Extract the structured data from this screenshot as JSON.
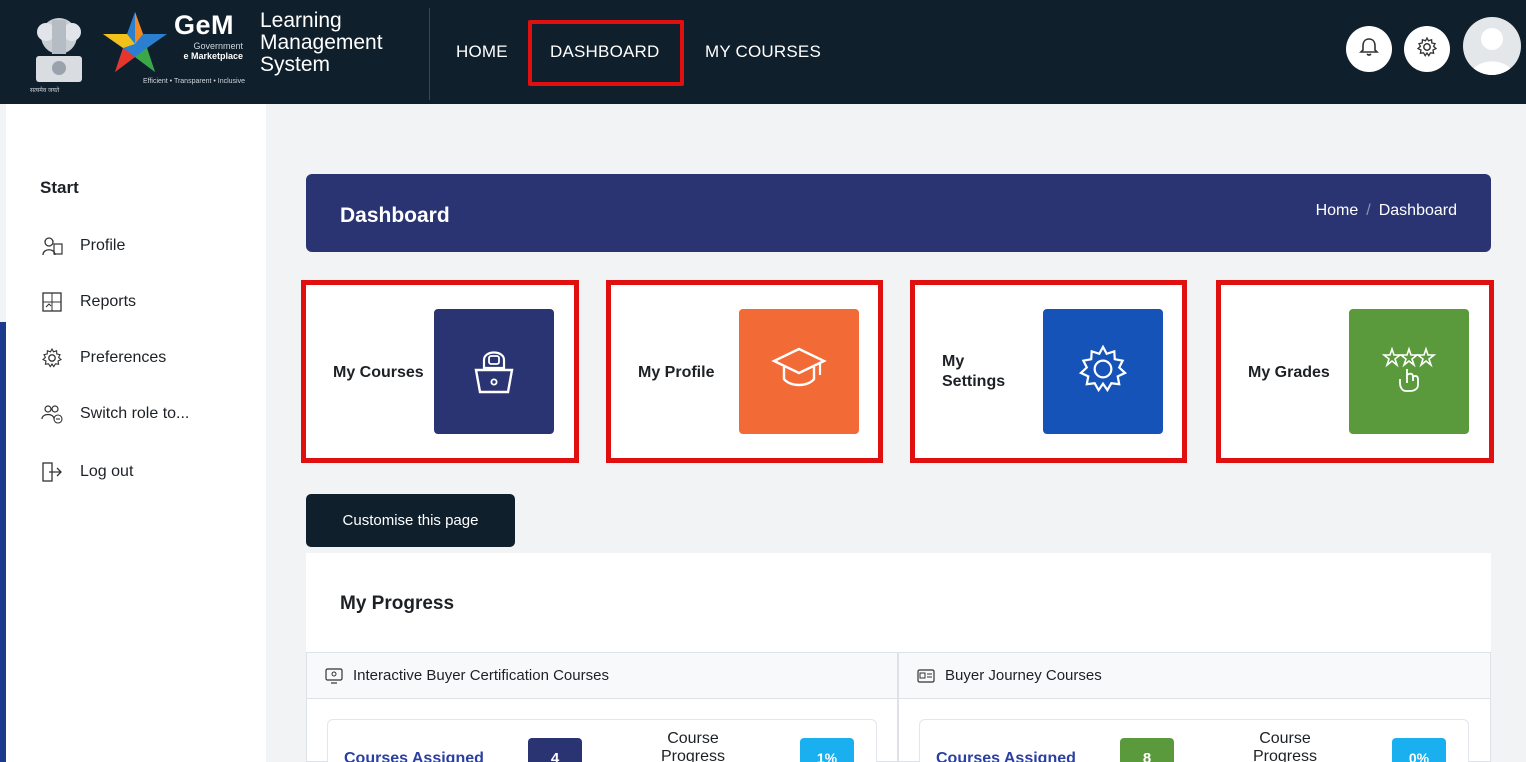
{
  "header": {
    "brand_word": "GeM",
    "brand_sub1": "Government",
    "brand_sub2": "e Marketplace",
    "brand_tagline": "Efficient • Transparent • Inclusive",
    "emblem_caption": "सत्यमेव जयते",
    "lms_title": "Learning Management System",
    "nav": {
      "home": "HOME",
      "dashboard": "DASHBOARD",
      "my_courses": "MY COURSES"
    },
    "icons": {
      "notifications": "bell-icon",
      "settings": "gear-icon",
      "avatar": "user-avatar"
    }
  },
  "sidebar": {
    "section": "Start",
    "items": [
      {
        "label": "Profile",
        "icon": "profile-icon"
      },
      {
        "label": "Reports",
        "icon": "reports-icon"
      },
      {
        "label": "Preferences",
        "icon": "gear-icon"
      },
      {
        "label": "Switch role to...",
        "icon": "switch-role-icon"
      },
      {
        "label": "Log out",
        "icon": "logout-icon"
      }
    ]
  },
  "banner": {
    "title": "Dashboard",
    "breadcrumb": [
      "Home",
      "Dashboard"
    ],
    "separator": "/"
  },
  "tiles": [
    {
      "label": "My Courses",
      "icon": "laptop-user-icon",
      "color": "#2b3473"
    },
    {
      "label": "My Profile",
      "icon": "graduation-cap-icon",
      "color": "#f26a36"
    },
    {
      "label": "My Settings",
      "icon": "gear-icon",
      "color": "#1553b8"
    },
    {
      "label": "My Grades",
      "icon": "stars-hand-icon",
      "color": "#5a9a3c"
    }
  ],
  "customise_label": "Customise this page",
  "progress": {
    "title": "My Progress",
    "panels": [
      {
        "heading": "Interactive Buyer Certification Courses",
        "stat_label": "Courses Assigned",
        "count": "4",
        "count_color": "#2b3473",
        "progress_label": "Course Progress",
        "percent": "1%"
      },
      {
        "heading": "Buyer Journey Courses",
        "stat_label": "Courses Assigned",
        "count": "8",
        "count_color": "#5a9a3c",
        "progress_label": "Course Progress",
        "percent": "0%"
      }
    ]
  },
  "colors": {
    "nav_bg": "#0f1f2c",
    "banner_bg": "#2b3473",
    "highlight_border": "#e11010",
    "percent_badge": "#1ab0f0"
  }
}
